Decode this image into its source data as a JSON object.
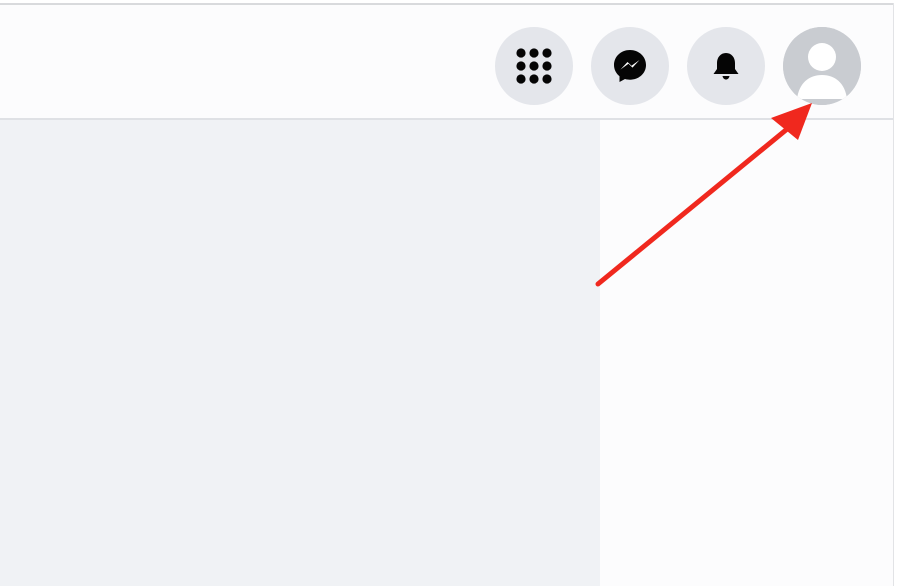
{
  "header": {
    "buttons": [
      {
        "id": "menu",
        "icon": "grid-menu-icon"
      },
      {
        "id": "messenger",
        "icon": "messenger-icon"
      },
      {
        "id": "notifications",
        "icon": "bell-icon"
      },
      {
        "id": "account",
        "icon": "default-avatar-icon"
      }
    ]
  },
  "annotation": {
    "type": "arrow",
    "color": "#f0281e",
    "target": "account-avatar-button"
  },
  "colors": {
    "background": "#f0f2f5",
    "button_background": "#e4e6eb",
    "icon": "#050505",
    "avatar_background": "#c9ccd1",
    "arrow": "#f0281e"
  }
}
